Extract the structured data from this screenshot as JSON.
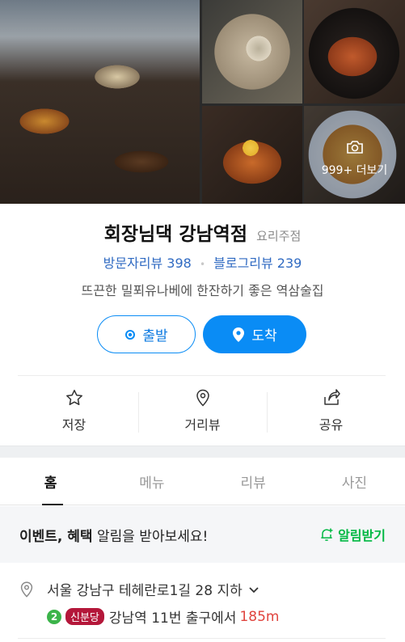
{
  "photos": {
    "more_label": "999+ 더보기"
  },
  "place": {
    "name": "회장님댁 강남역점",
    "category": "요리주점",
    "visitor_reviews": "방문자리뷰 398",
    "blog_reviews": "블로그리뷰 239",
    "description": "뜨끈한 밀푀유나베에 한잔하기 좋은 역삼술집"
  },
  "buttons": {
    "depart": "출발",
    "arrive": "도착"
  },
  "actions": [
    {
      "label": "저장",
      "icon": "star-icon"
    },
    {
      "label": "거리뷰",
      "icon": "location-pin-icon"
    },
    {
      "label": "공유",
      "icon": "share-icon"
    }
  ],
  "tabs": [
    {
      "label": "홈",
      "active": true
    },
    {
      "label": "메뉴",
      "active": false
    },
    {
      "label": "리뷰",
      "active": false
    },
    {
      "label": "사진",
      "active": false
    }
  ],
  "notice": {
    "bold": "이벤트, 혜택",
    "rest": " 알림을 받아보세요!",
    "action": "알림받기"
  },
  "address": {
    "text": "서울 강남구 테헤란로1길 28 지하",
    "line_number": "2",
    "line_name": "신분당",
    "directions": "강남역 11번 출구에서",
    "distance": "185m"
  },
  "colors": {
    "accent": "#0a8cf5",
    "green": "#00b843",
    "line2": "#3cb44a",
    "sinbundang": "#b4173a",
    "distance": "#e0443e"
  }
}
